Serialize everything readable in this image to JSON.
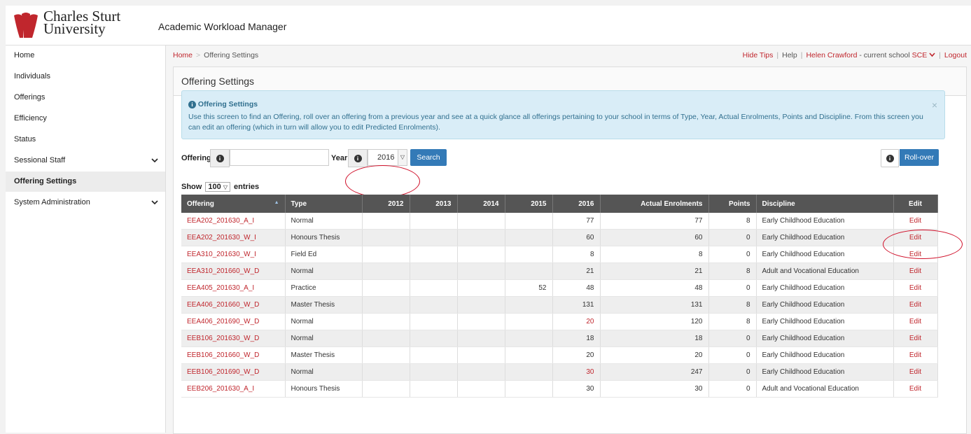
{
  "brand": {
    "line1": "Charles Sturt",
    "line2": "University",
    "app_title": "Academic Workload Manager"
  },
  "sidebar": {
    "items": [
      {
        "label": "Home",
        "expandable": false,
        "active": false
      },
      {
        "label": "Individuals",
        "expandable": false,
        "active": false
      },
      {
        "label": "Offerings",
        "expandable": false,
        "active": false
      },
      {
        "label": "Efficiency",
        "expandable": false,
        "active": false
      },
      {
        "label": "Status",
        "expandable": false,
        "active": false
      },
      {
        "label": "Sessional Staff",
        "expandable": true,
        "active": false
      },
      {
        "label": "Offering Settings",
        "expandable": false,
        "active": true
      },
      {
        "label": "System Administration",
        "expandable": true,
        "active": false
      }
    ]
  },
  "breadcrumb": {
    "home": "Home",
    "sep": ">",
    "current": "Offering Settings"
  },
  "topbar": {
    "hide_tips": "Hide Tips",
    "help": "Help",
    "user": "Helen Crawford",
    "school_text": " - current school ",
    "school": "SCE",
    "logout": "Logout"
  },
  "panel": {
    "title": "Offering Settings"
  },
  "tips": {
    "title": "Offering Settings",
    "body": "Use this screen to find an Offering, roll over an offering from a previous year and see at a quick glance all offerings pertaining to your school in terms of Type, Year, Actual Enrolments, Points and Discipline. From this screen you can edit an offering (which in turn will allow you to edit Predicted Enrolments).",
    "close": "×"
  },
  "search": {
    "offering_label": "Offering",
    "offering_value": "",
    "year_label": "Year",
    "year_value": "2016",
    "search_button": "Search",
    "rollover_button": "Roll-over"
  },
  "entries": {
    "show": "Show",
    "count": "100",
    "suffix": "entries"
  },
  "table": {
    "headers": [
      "Offering",
      "Type",
      "2012",
      "2013",
      "2014",
      "2015",
      "2016",
      "Actual Enrolments",
      "Points",
      "Discipline",
      "Edit"
    ],
    "rows": [
      {
        "offering": "EEA202_201630_A_I",
        "type": "Normal",
        "y2012": "",
        "y2013": "",
        "y2014": "",
        "y2015": "",
        "y2016": "77",
        "actual": "77",
        "points": "8",
        "discipline": "Early Childhood Education",
        "edit": "Edit"
      },
      {
        "offering": "EEA202_201630_W_I",
        "type": "Honours Thesis",
        "y2012": "",
        "y2013": "",
        "y2014": "",
        "y2015": "",
        "y2016": "60",
        "actual": "60",
        "points": "0",
        "discipline": "Early Childhood Education",
        "edit": "Edit"
      },
      {
        "offering": "EEA310_201630_W_I",
        "type": "Field Ed",
        "y2012": "",
        "y2013": "",
        "y2014": "",
        "y2015": "",
        "y2016": "8",
        "actual": "8",
        "points": "0",
        "discipline": "Early Childhood Education",
        "edit": "Edit"
      },
      {
        "offering": "EEA310_201660_W_D",
        "type": "Normal",
        "y2012": "",
        "y2013": "",
        "y2014": "",
        "y2015": "",
        "y2016": "21",
        "actual": "21",
        "points": "8",
        "discipline": "Adult and Vocational Education",
        "edit": "Edit"
      },
      {
        "offering": "EEA405_201630_A_I",
        "type": "Practice",
        "y2012": "",
        "y2013": "",
        "y2014": "",
        "y2015": "52",
        "y2016": "48",
        "actual": "48",
        "points": "0",
        "discipline": "Early Childhood Education",
        "edit": "Edit"
      },
      {
        "offering": "EEA406_201660_W_D",
        "type": "Master Thesis",
        "y2012": "",
        "y2013": "",
        "y2014": "",
        "y2015": "",
        "y2016": "131",
        "actual": "131",
        "points": "8",
        "discipline": "Early Childhood Education",
        "edit": "Edit"
      },
      {
        "offering": "EEA406_201690_W_D",
        "type": "Normal",
        "y2012": "",
        "y2013": "",
        "y2014": "",
        "y2015": "",
        "y2016": "20",
        "y2016_flag": true,
        "actual": "120",
        "points": "8",
        "discipline": "Early Childhood Education",
        "edit": "Edit"
      },
      {
        "offering": "EEB106_201630_W_D",
        "type": "Normal",
        "y2012": "",
        "y2013": "",
        "y2014": "",
        "y2015": "",
        "y2016": "18",
        "actual": "18",
        "points": "0",
        "discipline": "Early Childhood Education",
        "edit": "Edit"
      },
      {
        "offering": "EEB106_201660_W_D",
        "type": "Master Thesis",
        "y2012": "",
        "y2013": "",
        "y2014": "",
        "y2015": "",
        "y2016": "20",
        "actual": "20",
        "points": "0",
        "discipline": "Early Childhood Education",
        "edit": "Edit"
      },
      {
        "offering": "EEB106_201690_W_D",
        "type": "Normal",
        "y2012": "",
        "y2013": "",
        "y2014": "",
        "y2015": "",
        "y2016": "30",
        "y2016_flag": true,
        "actual": "247",
        "points": "0",
        "discipline": "Early Childhood Education",
        "edit": "Edit"
      },
      {
        "offering": "EEB206_201630_A_I",
        "type": "Honours Thesis",
        "y2012": "",
        "y2013": "",
        "y2014": "",
        "y2015": "",
        "y2016": "30",
        "actual": "30",
        "points": "0",
        "discipline": "Adult and Vocational Education",
        "edit": "Edit"
      }
    ]
  },
  "colors": {
    "brand_red": "#c0262d",
    "primary_blue": "#337ab7",
    "header_grey": "#555555",
    "annotation_red": "#d0102a"
  }
}
